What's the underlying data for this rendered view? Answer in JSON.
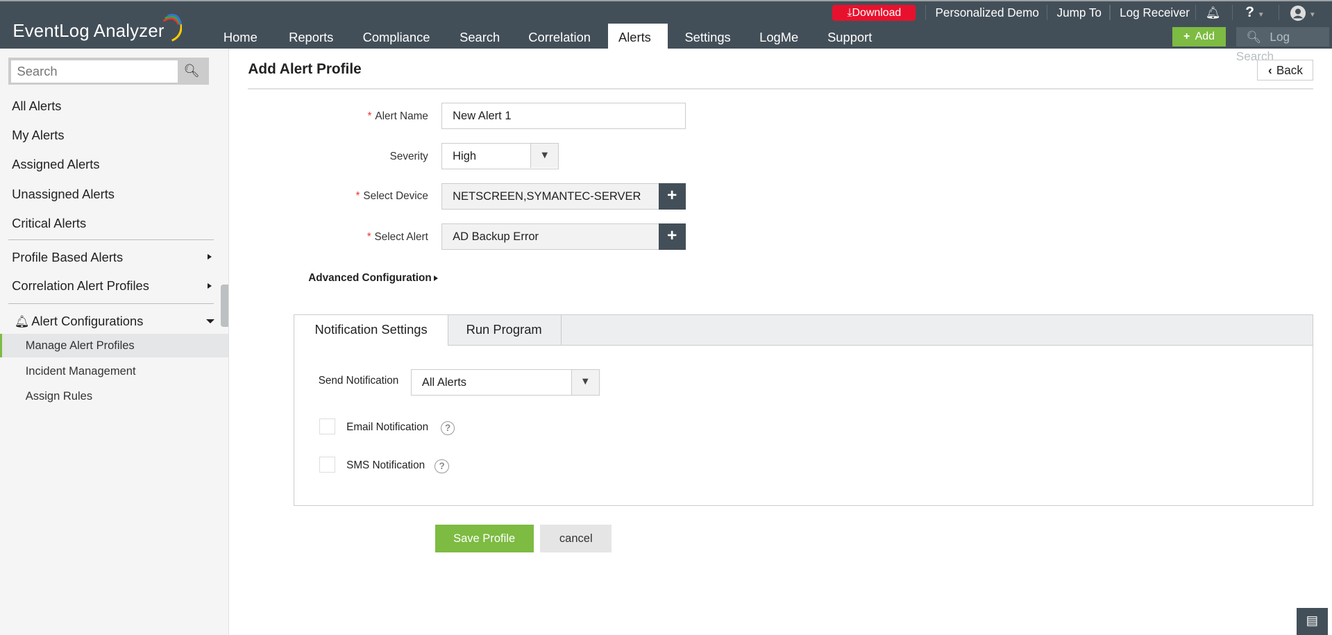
{
  "app": {
    "title": "EventLog Analyzer"
  },
  "topbar": {
    "download": "Download",
    "personalized_demo": "Personalized Demo",
    "jump_to": "Jump To",
    "log_receiver": "Log Receiver",
    "help": "?",
    "add": "Add",
    "log_search_placeholder": "Log Search"
  },
  "nav": [
    "Home",
    "Reports",
    "Compliance",
    "Search",
    "Correlation",
    "Alerts",
    "Settings",
    "LogMe",
    "Support"
  ],
  "sidebar": {
    "search_placeholder": "Search",
    "items": [
      "All Alerts",
      "My Alerts",
      "Assigned Alerts",
      "Unassigned Alerts",
      "Critical Alerts"
    ],
    "groups": [
      "Profile Based Alerts",
      "Correlation Alert Profiles"
    ],
    "config_header": "Alert Configurations",
    "sub_items": [
      "Manage Alert Profiles",
      "Incident Management",
      "Assign Rules"
    ]
  },
  "page": {
    "title": "Add Alert Profile",
    "back": "Back",
    "form": {
      "alert_name_label": "Alert Name",
      "alert_name_value": "New Alert 1",
      "severity_label": "Severity",
      "severity_value": "High",
      "device_label": "Select Device",
      "device_value": "NETSCREEN,SYMANTEC-SERVER",
      "alert_label": "Select Alert",
      "alert_value": "AD Backup Error",
      "required_mark": "*"
    },
    "advanced": "Advanced Configuration",
    "tabs": [
      "Notification Settings",
      "Run Program"
    ],
    "notification": {
      "send_label": "Send Notification",
      "send_value": "All Alerts",
      "email": "Email Notification",
      "sms": "SMS Notification"
    },
    "save": "Save Profile",
    "cancel": "cancel"
  },
  "colors": {
    "header": "#434f58",
    "accent_green": "#7dbb42",
    "download_red": "#e8112d"
  }
}
